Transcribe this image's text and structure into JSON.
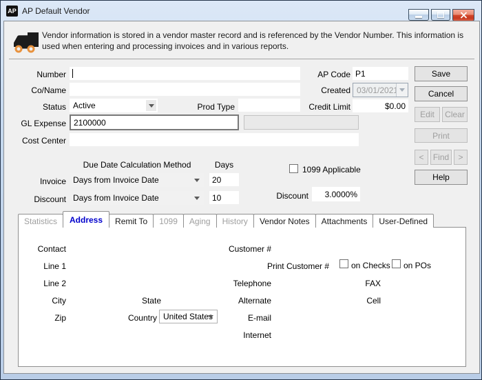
{
  "window": {
    "icon": "AP",
    "title": "AP Default Vendor"
  },
  "info_text": "Vendor information is stored in a vendor master record and is referenced by the Vendor Number. This information is used when entering and processing invoices and in various reports.",
  "fields": {
    "number": {
      "label": "Number",
      "value": ""
    },
    "co_name": {
      "label": "Co/Name",
      "value": ""
    },
    "status": {
      "label": "Status",
      "value": "Active"
    },
    "prod_type": {
      "label": "Prod Type",
      "value": ""
    },
    "gl_expense": {
      "label": "GL Expense",
      "value": "2100000"
    },
    "cost_center": {
      "label": "Cost Center",
      "value": ""
    },
    "ap_code": {
      "label": "AP Code",
      "value": "P1"
    },
    "created": {
      "label": "Created",
      "value": "03/01/2021"
    },
    "credit_limit": {
      "label": "Credit Limit",
      "value": "$0.00"
    }
  },
  "due_date": {
    "method_header": "Due Date Calculation Method",
    "days_header": "Days",
    "invoice": {
      "label": "Invoice",
      "method": "Days from Invoice Date",
      "days": "20"
    },
    "discount": {
      "label": "Discount",
      "method": "Days from Invoice Date",
      "days": "10"
    }
  },
  "flags": {
    "applicable_1099": {
      "label": "1099 Applicable",
      "checked": false
    }
  },
  "discount_pct": {
    "label": "Discount",
    "value": "3.0000%"
  },
  "buttons": {
    "save": "Save",
    "cancel": "Cancel",
    "edit": "Edit",
    "clear": "Clear",
    "print": "Print",
    "prev": "<",
    "find": "Find",
    "next": ">",
    "help": "Help"
  },
  "tabs": [
    {
      "label": "Statistics",
      "state": "dim"
    },
    {
      "label": "Address",
      "state": "active"
    },
    {
      "label": "Remit To",
      "state": "normal"
    },
    {
      "label": "1099",
      "state": "dim"
    },
    {
      "label": "Aging",
      "state": "dim"
    },
    {
      "label": "History",
      "state": "dim"
    },
    {
      "label": "Vendor Notes",
      "state": "normal"
    },
    {
      "label": "Attachments",
      "state": "normal"
    },
    {
      "label": "User-Defined",
      "state": "normal"
    }
  ],
  "address_tab": {
    "contact": "Contact",
    "line1": "Line 1",
    "line2": "Line 2",
    "city": "City",
    "state": "State",
    "zip": "Zip",
    "country_label": "Country",
    "country_value": "United States",
    "customer_no": "Customer #",
    "print_customer": "Print Customer #",
    "on_checks": "on Checks",
    "on_pos": "on POs",
    "telephone": "Telephone",
    "fax": "FAX",
    "alternate": "Alternate",
    "cell": "Cell",
    "email": "E-mail",
    "internet": "Internet"
  },
  "colors": {
    "titlebar": "#c6d9ef",
    "dialog_bg": "#f0f0f0",
    "active_tab_text": "#0000cc",
    "close_button": "#d2452a"
  }
}
